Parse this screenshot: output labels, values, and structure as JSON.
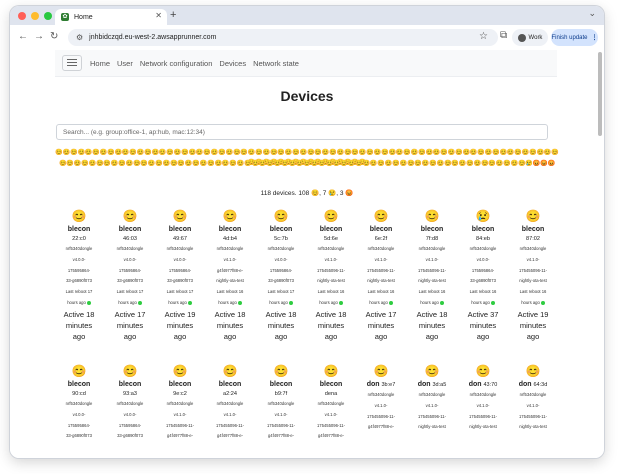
{
  "browser": {
    "tab_title": "Home",
    "url": "jnhbidczqd.eu-west-2.awsapprunner.com",
    "profile_label": "Work",
    "update_label": "Finish update"
  },
  "nav": {
    "links": [
      "Home",
      "User",
      "Network configuration",
      "Devices",
      "Network state"
    ]
  },
  "page": {
    "title": "Devices",
    "search_placeholder": "Search... (e.g. group:office-1, ap:hub, mac:12:34)",
    "summary": "118 devices. 108 😊, 7 😢, 3 😡"
  },
  "smileys": {
    "line1": "😊😊😊😊😊😊😊😊😊😊😊😊😊😊😊😊😊😊😊😊😊😊😊😊😊😊😊😊😊😊😊😊😊😊😊😊😊😊😊😊😊😊😊😊😊😊😊😊😊😊😊😊😊😊😊😊😊😊😊😊😊😊😊😊😊😊😊😊😊😊😊😊😊😊😊😊😊😊😊😊😊😊😊😊",
    "line2": "😊😊😊😊😊😊😊😊😊😊😊😊😊😊😊😊😊😊😊😊😊😊😊😊😊😊😊😊😊😊😊😊😊😊😊😊😊😊😊😊😊😊😊😊😊😊😊😊😊😊😊😊😊😊😊😊😊😊😊😊😊😊😊😢😡😡😡"
  },
  "devices_row1": [
    {
      "emoji": "😊",
      "name": "blecon",
      "mac": "22:c0",
      "model": "nrf5340dongle",
      "version": "v4.0.0-",
      "build": "175595864-",
      "hash": "33-g6890f073",
      "reboot": "Last reboot 17",
      "ago": "hours ago",
      "active": "Active 18",
      "unit": "minutes",
      "tail": "ago"
    },
    {
      "emoji": "😊",
      "name": "blecon",
      "mac": "46:03",
      "model": "nrf5340dongle",
      "version": "v4.0.0-",
      "build": "175595864-",
      "hash": "33-g6890f073",
      "reboot": "Last reboot 17",
      "ago": "hours ago",
      "active": "Active 17",
      "unit": "minutes",
      "tail": "ago"
    },
    {
      "emoji": "😊",
      "name": "blecon",
      "mac": "49:67",
      "model": "nrf5340dongle",
      "version": "v4.0.0-",
      "build": "175595864-",
      "hash": "33-g6890f073",
      "reboot": "Last reboot 17",
      "ago": "hours ago",
      "active": "Active 19",
      "unit": "minutes",
      "tail": "ago"
    },
    {
      "emoji": "😊",
      "name": "blecon",
      "mac": "4d:b4",
      "model": "nrf5340dongle",
      "version": "v4.1.0-",
      "build": "g4f4977f88-e-",
      "hash": "nightly-ota-test",
      "reboot": "Last reboot 16",
      "ago": "hours ago",
      "active": "Active 18",
      "unit": "minutes",
      "tail": "ago"
    },
    {
      "emoji": "😊",
      "name": "blecon",
      "mac": "5c:7b",
      "model": "nrf5340dongle",
      "version": "v4.0.0-",
      "build": "175595864-",
      "hash": "33-g6890f073",
      "reboot": "Last reboot 17",
      "ago": "hours ago",
      "active": "Active 18",
      "unit": "minutes",
      "tail": "ago"
    },
    {
      "emoji": "😊",
      "name": "blecon",
      "mac": "5d:6e",
      "model": "nrf5340dongle",
      "version": "v4.1.0-",
      "build": "175455096-11-",
      "hash": "nightly-ota-test",
      "reboot": "Last reboot 16",
      "ago": "hours ago",
      "active": "Active 18",
      "unit": "minutes",
      "tail": "ago"
    },
    {
      "emoji": "😊",
      "name": "blecon",
      "mac": "6e:2f",
      "model": "nrf5340dongle",
      "version": "v4.1.0-",
      "build": "175455096-11-",
      "hash": "nightly-ota-test",
      "reboot": "Last reboot 16",
      "ago": "hours ago",
      "active": "Active 17",
      "unit": "minutes",
      "tail": "ago"
    },
    {
      "emoji": "😊",
      "name": "blecon",
      "mac": "7f:d8",
      "model": "nrf5340dongle",
      "version": "v4.1.0-",
      "build": "175455096-11-",
      "hash": "nightly-ota-test",
      "reboot": "Last reboot 16",
      "ago": "hours ago",
      "active": "Active 18",
      "unit": "minutes",
      "tail": "ago"
    },
    {
      "emoji": "😢",
      "name": "blecon",
      "mac": "84:eb",
      "model": "nrf5340dongle",
      "version": "v4.0.0-",
      "build": "175595864-",
      "hash": "33-g6890f073",
      "reboot": "Last reboot 16",
      "ago": "hours ago",
      "active": "Active 37",
      "unit": "minutes",
      "tail": "ago"
    },
    {
      "emoji": "😊",
      "name": "blecon",
      "mac": "87:02",
      "model": "nrf5340dongle",
      "version": "v4.1.0-",
      "build": "175455096-11-",
      "hash": "nightly-ota-test",
      "reboot": "Last reboot 16",
      "ago": "hours ago",
      "active": "Active 19",
      "unit": "minutes",
      "tail": "ago"
    }
  ],
  "devices_row2": [
    {
      "emoji": "😊",
      "name": "blecon",
      "mac": "90:cd",
      "model": "nrf5340dongle",
      "version": "v4.0.0-",
      "build": "175595864-",
      "hash": "33-g6890f073"
    },
    {
      "emoji": "😊",
      "name": "blecon",
      "mac": "93:a3",
      "model": "nrf5340dongle",
      "version": "v4.0.0-",
      "build": "175595864-",
      "hash": "33-g6890f073"
    },
    {
      "emoji": "😊",
      "name": "blecon",
      "mac": "9e:c2",
      "model": "nrf5340dongle",
      "version": "v4.1.0-",
      "build": "175455096-11-",
      "hash": "g4f4977f88-e-"
    },
    {
      "emoji": "😊",
      "name": "blecon",
      "mac": "a2:24",
      "model": "nrf5340dongle",
      "version": "v4.1.0-",
      "build": "175455096-11-",
      "hash": "g4f4977f88-e-"
    },
    {
      "emoji": "😊",
      "name": "blecon",
      "mac": "b9:7f",
      "model": "nrf5340dongle",
      "version": "v4.1.0-",
      "build": "175455096-11-",
      "hash": "g4f4977f88-e-"
    },
    {
      "emoji": "😊",
      "name": "blecon",
      "mac": "dena",
      "model": "nrf5340dongle",
      "version": "v4.1.0-",
      "build": "175455096-11-",
      "hash": "g4f4977f88-e-"
    },
    {
      "emoji": "😊",
      "name": "don",
      "mac": "3b:e7",
      "model": "nrf5340dongle",
      "version": "v4.1.0-",
      "build": "175455096-11-",
      "hash": "g4f4977f88-e-"
    },
    {
      "emoji": "😊",
      "name": "don",
      "mac": "3d:a5",
      "model": "nrf5340dongle",
      "version": "v4.1.0-",
      "build": "175455096-11-",
      "hash": "nightly-ota-test"
    },
    {
      "emoji": "😊",
      "name": "don",
      "mac": "43:70",
      "model": "nrf5340dongle",
      "version": "v4.1.0-",
      "build": "175455096-11-",
      "hash": "nightly-ota-test"
    },
    {
      "emoji": "😊",
      "name": "don",
      "mac": "64:3d",
      "model": "nrf5340dongle",
      "version": "v4.1.0-",
      "build": "175455096-11-",
      "hash": "nightly-ota-test"
    }
  ],
  "colors": {
    "dot_red": "#ff5f57",
    "dot_yellow": "#febc2e",
    "dot_green": "#28c840",
    "online": "#2ecc40"
  }
}
